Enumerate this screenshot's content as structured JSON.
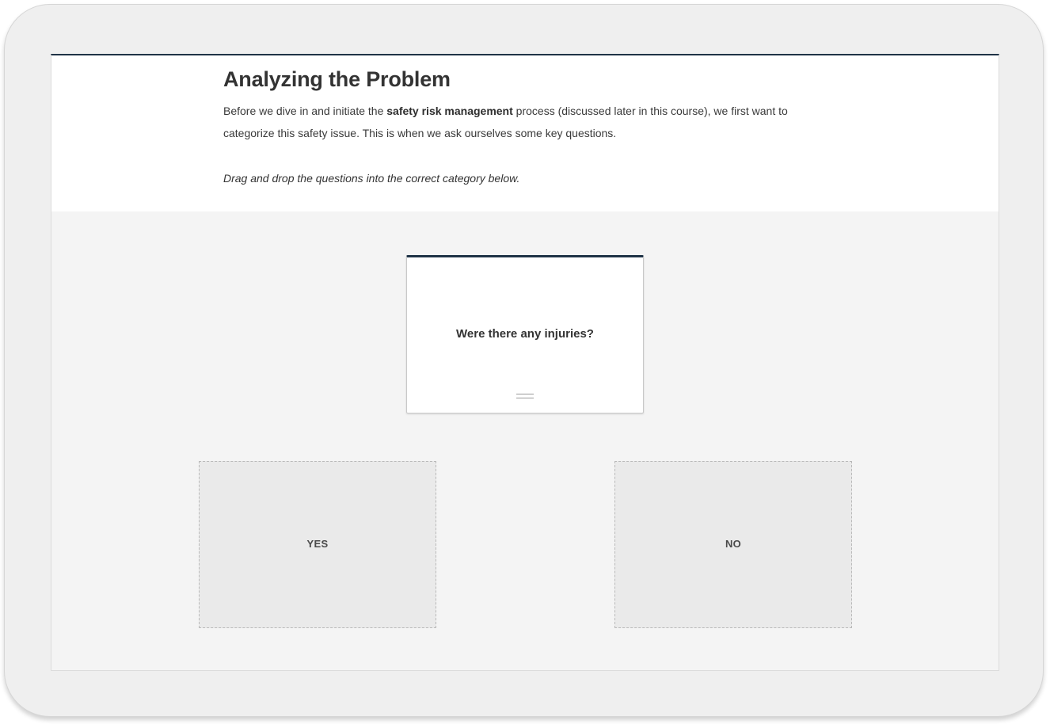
{
  "lesson": {
    "title": "Analyzing the Problem",
    "intro_before": "Before we dive in and initiate the ",
    "intro_bold": "safety risk management",
    "intro_after": " process (discussed later in this course), we first want to categorize this safety issue. This is when we ask ourselves some key questions.",
    "instruction": "Drag and drop the questions into the correct category below."
  },
  "activity": {
    "card_text": "Were there any injuries?",
    "categories": [
      {
        "label": "YES"
      },
      {
        "label": "NO"
      }
    ]
  }
}
